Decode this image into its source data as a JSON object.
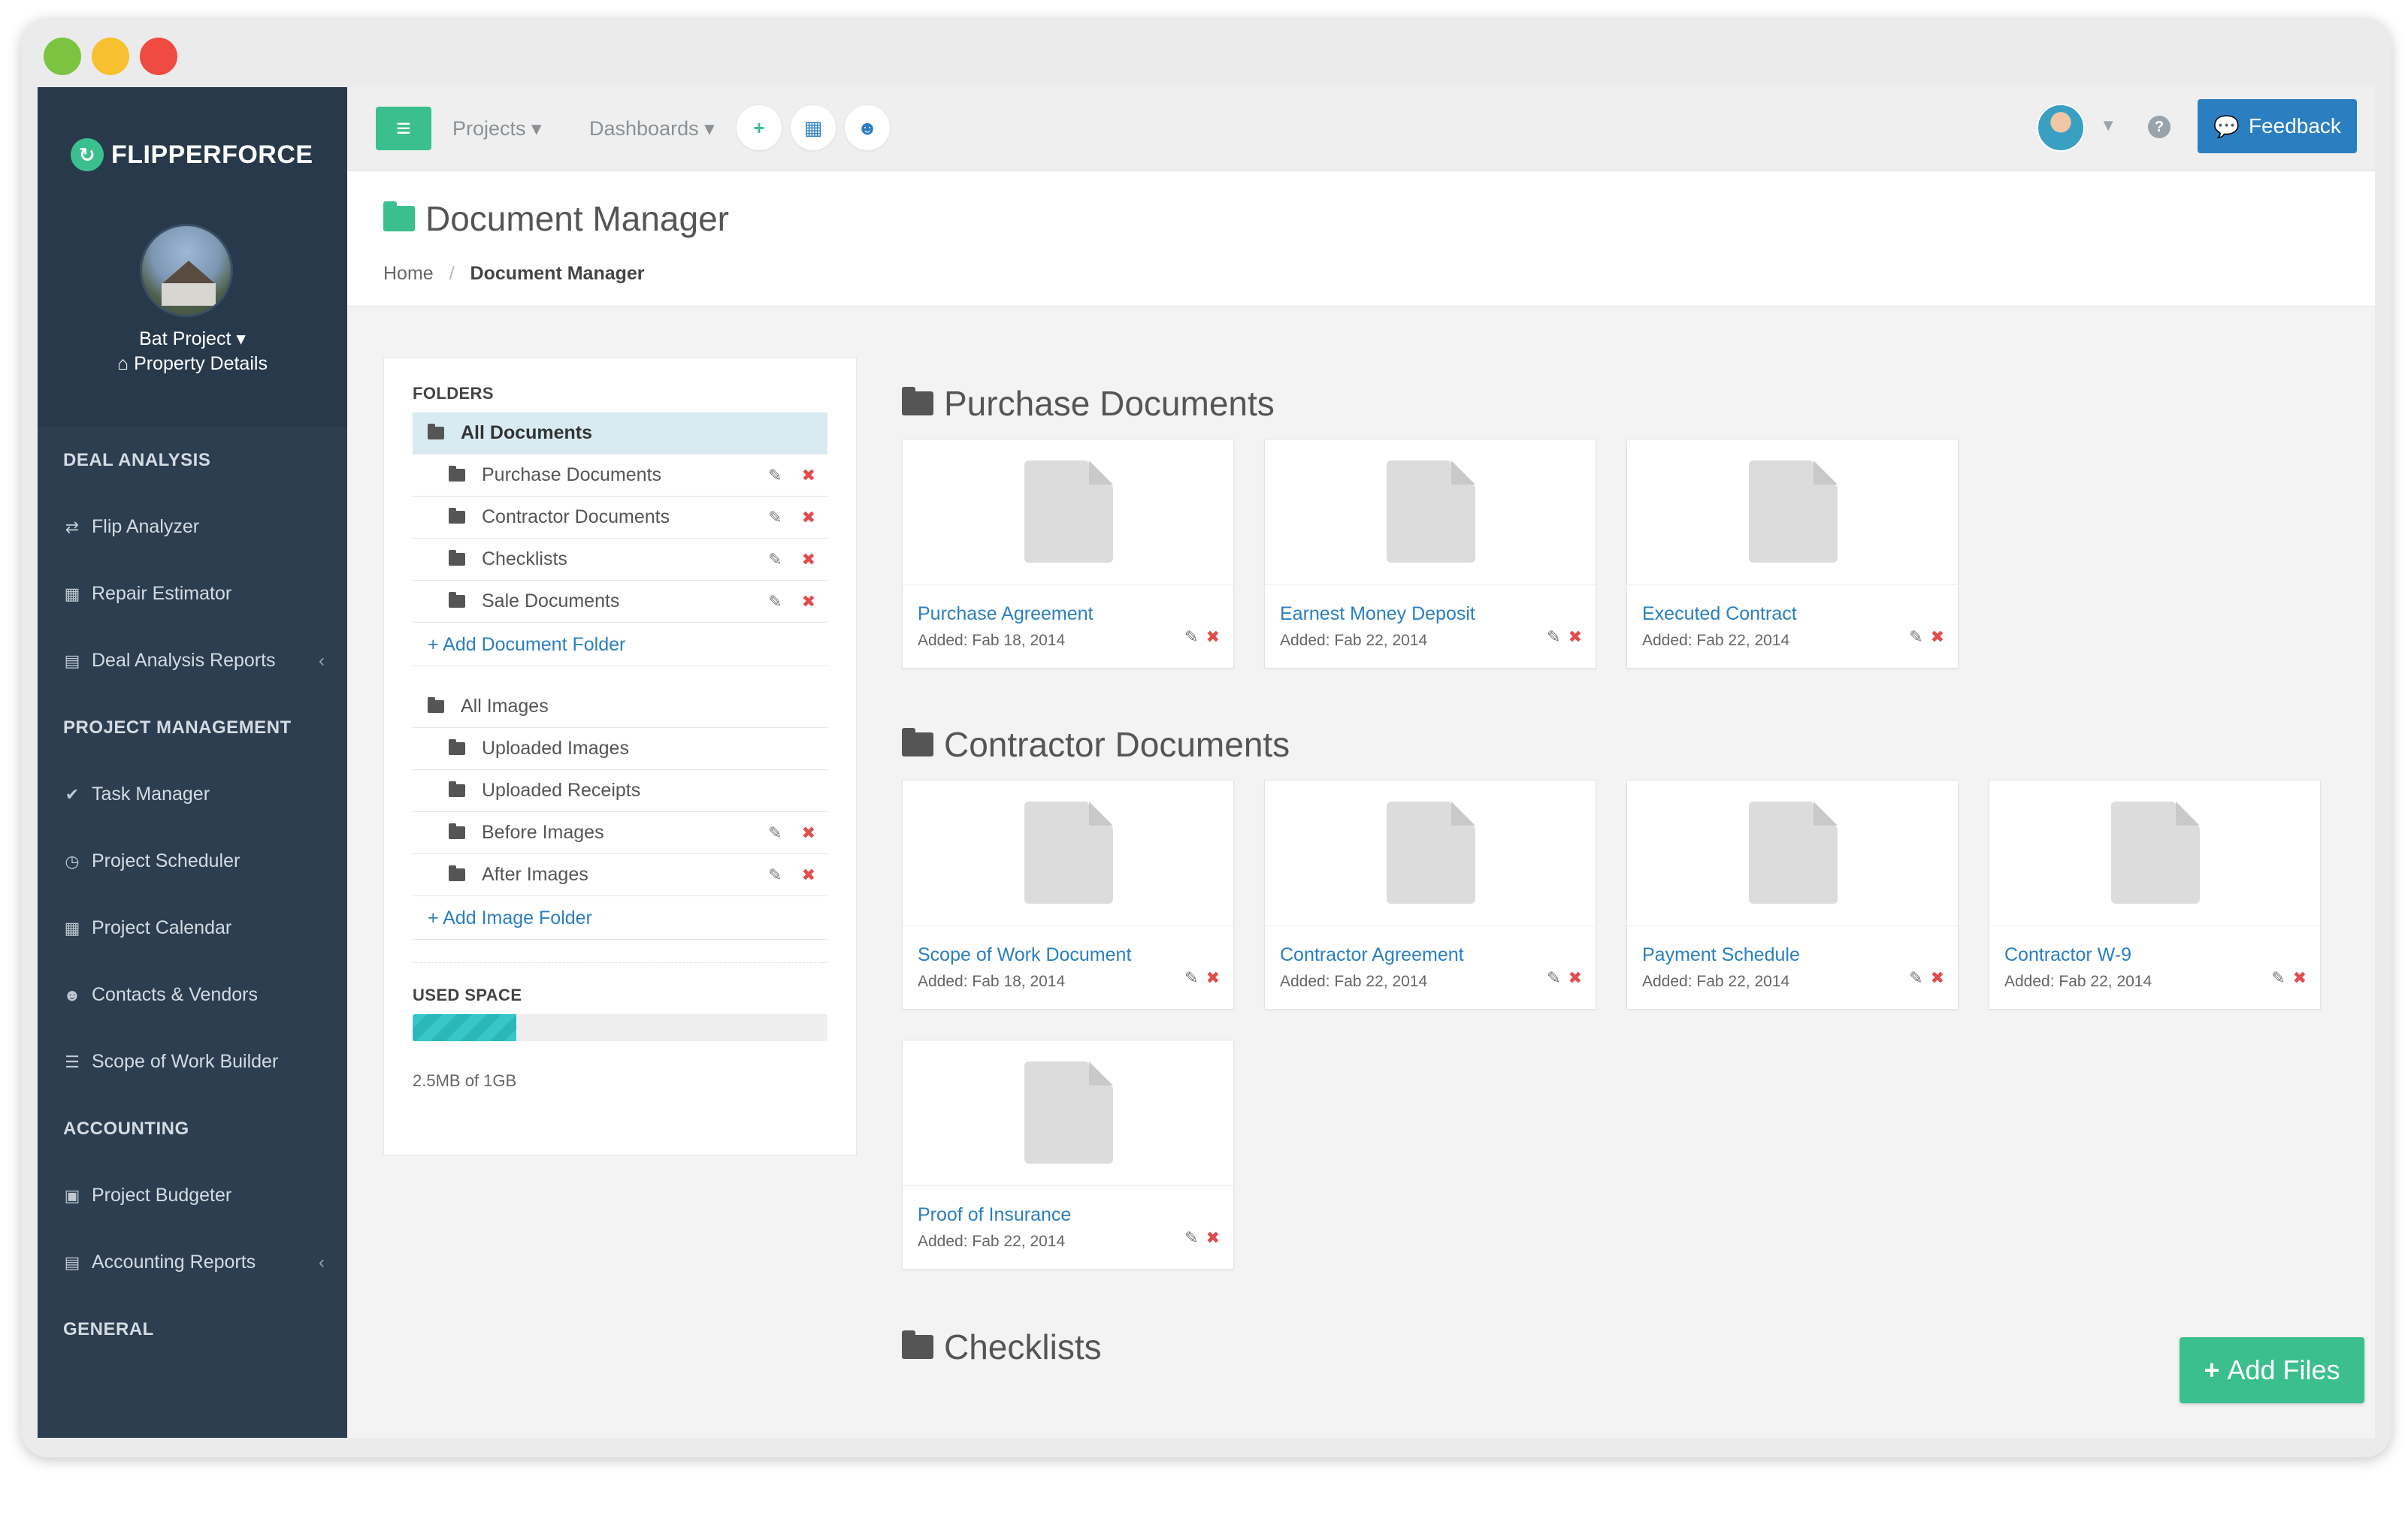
{
  "window": {
    "colors": {
      "close": "#f04b41",
      "minimize": "#f7c02e",
      "zoom": "#7dc342"
    }
  },
  "brand": {
    "name": "FLIPPERFORCE",
    "accent": "#3bbf8f",
    "blue": "#2b7fc1"
  },
  "project": {
    "name": "Bat Project ▾",
    "details": "Property Details"
  },
  "sidebar": {
    "sections": [
      {
        "title": "DEAL ANALYSIS",
        "items": [
          {
            "label": "Flip Analyzer",
            "icon": "exchange-icon"
          },
          {
            "label": "Repair Estimator",
            "icon": "calculator-icon"
          },
          {
            "label": "Deal Analysis Reports",
            "icon": "file-icon",
            "chevron": "‹"
          }
        ]
      },
      {
        "title": "PROJECT MANAGEMENT",
        "items": [
          {
            "label": "Task Manager",
            "icon": "check-circle-icon"
          },
          {
            "label": "Project Scheduler",
            "icon": "clock-icon"
          },
          {
            "label": "Project Calendar",
            "icon": "calendar-icon"
          },
          {
            "label": "Contacts & Vendors",
            "icon": "users-icon"
          },
          {
            "label": "Scope of Work Builder",
            "icon": "list-icon"
          }
        ]
      },
      {
        "title": "ACCOUNTING",
        "items": [
          {
            "label": "Project Budgeter",
            "icon": "money-icon"
          },
          {
            "label": "Accounting Reports",
            "icon": "file-icon",
            "chevron": "‹"
          }
        ]
      },
      {
        "title": "GENERAL",
        "items": []
      }
    ]
  },
  "topbar": {
    "projects": "Projects ▾",
    "dashboards": "Dashboards ▾",
    "feedback": "Feedback"
  },
  "page": {
    "title": "Document Manager",
    "breadcrumb": {
      "home": "Home",
      "sep": "/",
      "current": "Document Manager"
    }
  },
  "folders": {
    "label": "FOLDERS",
    "documents": [
      {
        "label": "All Documents",
        "active": true,
        "editable": false
      },
      {
        "label": "Purchase Documents",
        "editable": true
      },
      {
        "label": "Contractor Documents",
        "editable": true
      },
      {
        "label": "Checklists",
        "editable": true
      },
      {
        "label": "Sale Documents",
        "editable": true
      }
    ],
    "add_document_folder": "+ Add Document Folder",
    "images": [
      {
        "label": "All Images",
        "editable": false
      },
      {
        "label": "Uploaded Images",
        "editable": false
      },
      {
        "label": "Uploaded Receipts",
        "editable": false
      },
      {
        "label": "Before Images",
        "editable": true
      },
      {
        "label": "After Images",
        "editable": true
      }
    ],
    "add_image_folder": "+ Add Image Folder",
    "used_space_label": "USED SPACE",
    "used_space_fraction": 0.25,
    "used_space_text": "2.5MB of 1GB"
  },
  "sections": [
    {
      "title": "Purchase Documents",
      "files": [
        {
          "name": "Purchase Agreement",
          "date": "Added: Fab 18, 2014"
        },
        {
          "name": "Earnest Money Deposit",
          "date": "Added: Fab 22, 2014"
        },
        {
          "name": "Executed Contract",
          "date": "Added: Fab 22, 2014"
        }
      ]
    },
    {
      "title": "Contractor Documents",
      "files": [
        {
          "name": "Scope of Work Document",
          "date": "Added: Fab 18, 2014"
        },
        {
          "name": "Contractor Agreement",
          "date": "Added: Fab 22, 2014"
        },
        {
          "name": "Payment Schedule",
          "date": "Added: Fab 22, 2014"
        },
        {
          "name": "Contractor W-9",
          "date": "Added: Fab 22, 2014"
        },
        {
          "name": "Proof of Insurance",
          "date": "Added: Fab 22, 2014"
        }
      ]
    },
    {
      "title": "Checklists",
      "files": []
    }
  ],
  "actions": {
    "add_files": "Add Files"
  }
}
